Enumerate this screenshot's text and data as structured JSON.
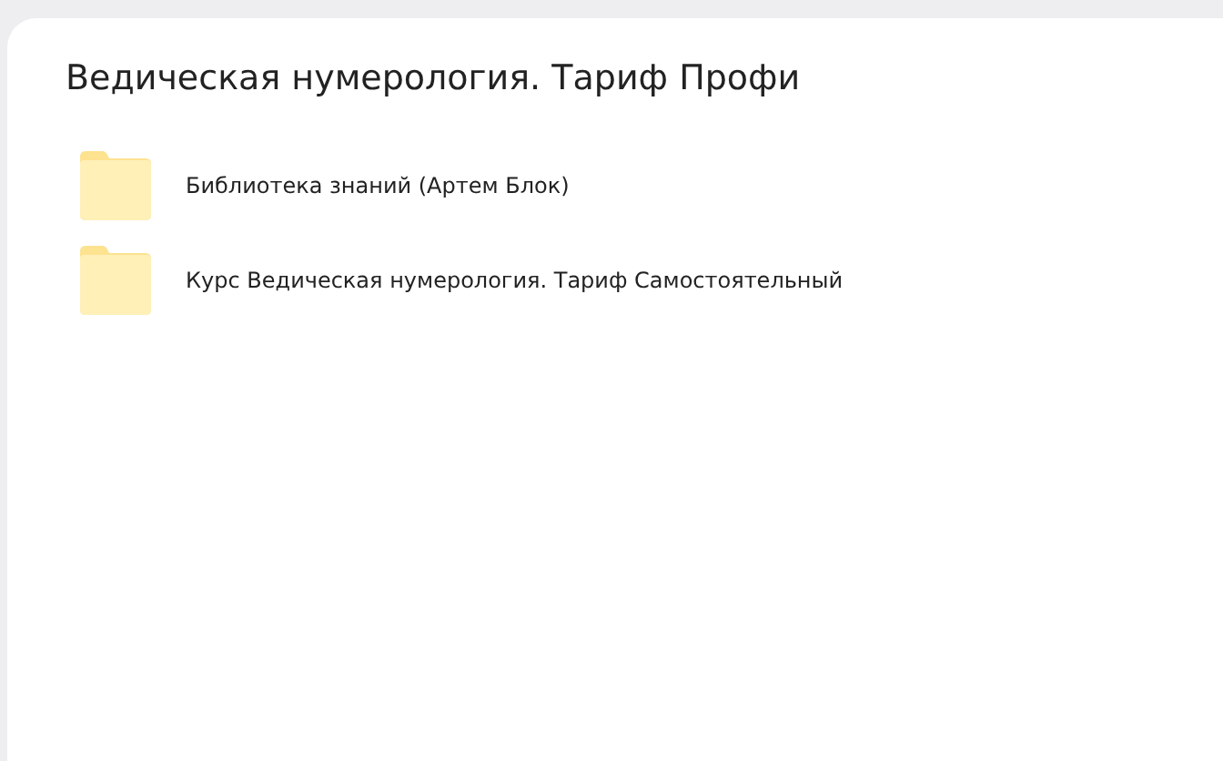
{
  "title": "Ведическая нумерология. Тариф Профи",
  "items": [
    {
      "kind": "folder",
      "name": "Библиотека знаний (Артем Блок)"
    },
    {
      "kind": "folder",
      "name": "Курс Ведическая нумерология. Тариф Самостоятельный"
    }
  ]
}
